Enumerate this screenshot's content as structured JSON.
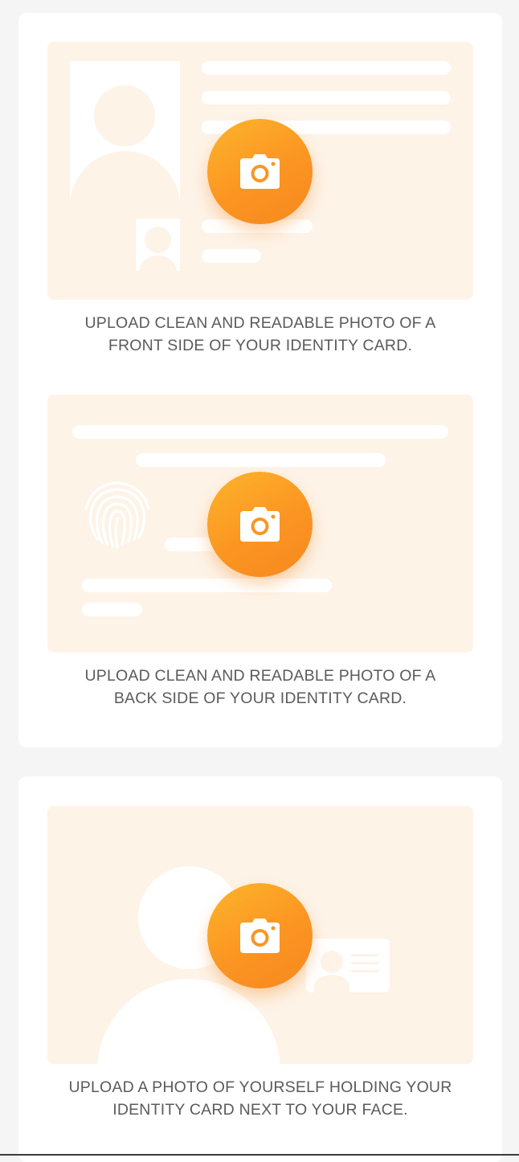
{
  "cards": [
    {
      "steps": [
        {
          "id": "front",
          "caption_line1": "UPLOAD CLEAN AND READABLE PHOTO OF A",
          "caption_line2": "FRONT SIDE OF YOUR IDENTITY CARD.",
          "icon": "camera-icon"
        },
        {
          "id": "back",
          "caption_line1": "UPLOAD CLEAN AND READABLE PHOTO OF A",
          "caption_line2": "BACK SIDE OF YOUR IDENTITY CARD.",
          "icon": "camera-icon"
        }
      ]
    },
    {
      "steps": [
        {
          "id": "selfie",
          "caption_line1": "UPLOAD A PHOTO OF YOURSELF HOLDING YOUR",
          "caption_line2": "IDENTITY CARD NEXT TO YOUR FACE.",
          "icon": "camera-icon"
        }
      ]
    }
  ],
  "colors": {
    "background": "#f5f5f5",
    "card": "#ffffff",
    "illustration_bg": "#fdf3e7",
    "accent_start": "#fdb42c",
    "accent_end": "#f7881f",
    "caption_text": "#5b5b5b"
  }
}
